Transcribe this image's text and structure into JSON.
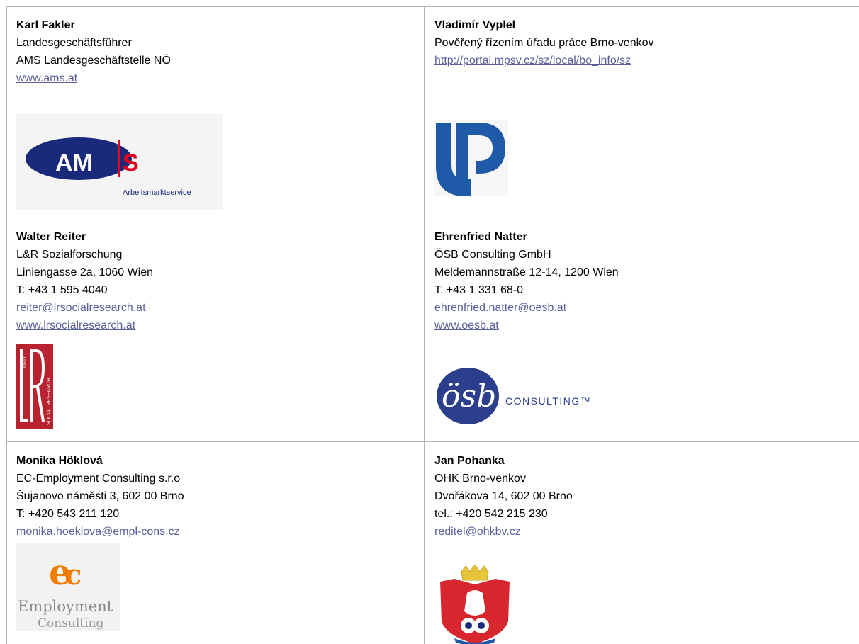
{
  "contacts": [
    {
      "name": "Karl Fakler",
      "lines": [
        "Landesgeschäftsführer",
        "AMS Landesgeschäftstelle NÖ"
      ],
      "links": [
        "www.ams.at"
      ],
      "logo": {
        "name": "ams-logo",
        "text": "AMS",
        "subtitle": "Arbeitsmarktservice"
      }
    },
    {
      "name": "Vladimír Vyplel",
      "lines": [
        "Pověřený řízením úřadu práce Brno-venkov"
      ],
      "links": [
        "http://portal.mpsv.cz/sz/local/bo_info/sz"
      ],
      "logo": {
        "name": "up-logo"
      }
    },
    {
      "name": "Walter Reiter",
      "lines": [
        "L&R Sozialforschung",
        "Liniengasse 2a, 1060 Wien",
        "T: +43 1 595 4040"
      ],
      "links": [
        "reiter@lrsocialresearch.at",
        "www.lrsocialresearch.at"
      ],
      "logo": {
        "name": "lr-logo",
        "text": "LR",
        "small": "UND",
        "side": "SOCIAL RESEARCH"
      }
    },
    {
      "name": "Ehrenfried Natter",
      "lines": [
        "ÖSB Consulting GmbH",
        "Meldemannstraße 12-14, 1200 Wien",
        "T: +43 1 331 68-0"
      ],
      "links": [
        "ehrenfried.natter@oesb.at",
        "www.oesb.at"
      ],
      "logo": {
        "name": "osb-logo",
        "text": "ösb",
        "subtitle": "CONSULTING™"
      }
    },
    {
      "name": "Monika Höklová",
      "lines": [
        "EC-Employment Consulting s.r.o",
        "Šujanovo náměsti 3, 602 00 Brno",
        "T: +420 543 211 120"
      ],
      "links": [
        "monika.hoeklova@empl-cons.cz"
      ],
      "logo": {
        "name": "ec-logo",
        "text": "Employment",
        "subtitle": "Consulting"
      }
    },
    {
      "name": "Jan Pohanka",
      "lines": [
        "OHK Brno-venkov",
        "Dvořákova 14, 602 00 Brno",
        "tel.: +420 542 215 230"
      ],
      "links": [
        "reditel@ohkbv.cz"
      ],
      "logo": {
        "name": "ohk-coat-of-arms-logo"
      }
    }
  ],
  "colors": {
    "border": "#b5b5b5",
    "link": "#5b5f9c",
    "ams_blue": "#1a2a7a",
    "ams_red": "#e2001a",
    "up_blue": "#1f5aa8",
    "lr_red": "#b8232f",
    "osb_blue": "#2b3f8c",
    "ec_orange": "#f07d00"
  }
}
